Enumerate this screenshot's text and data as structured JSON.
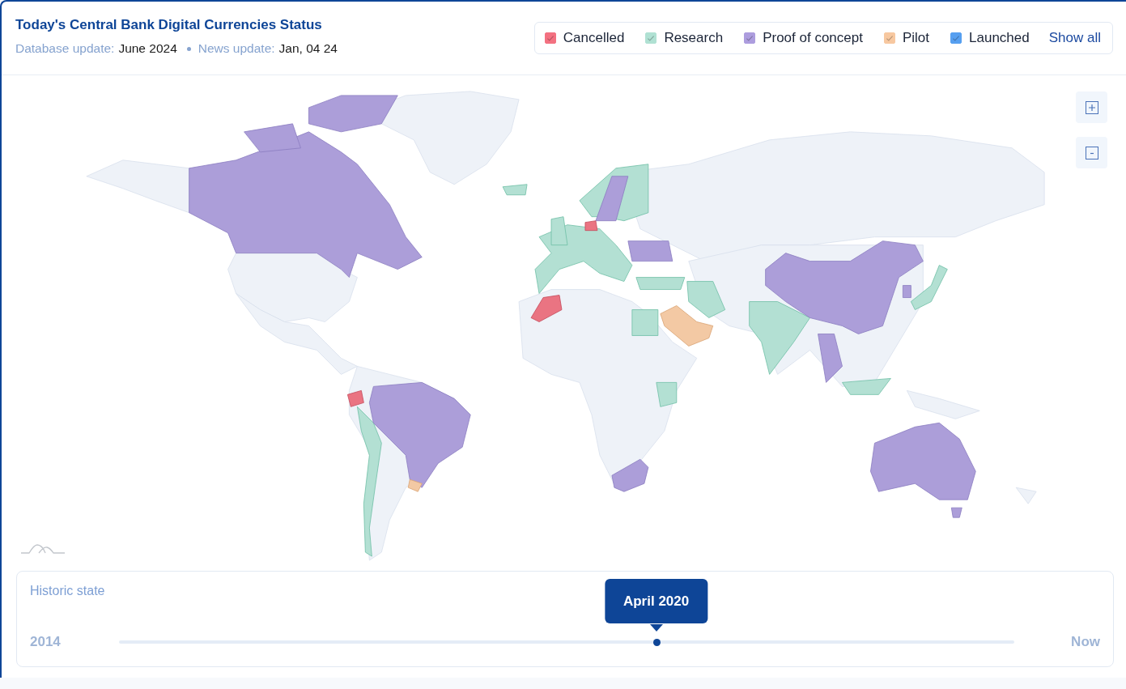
{
  "header": {
    "title": "Today's Central Bank Digital Currencies Status",
    "database_label": "Database update:",
    "database_value": "June 2024",
    "news_label": "News update:",
    "news_value": "Jan, 04 24"
  },
  "legend": {
    "items": [
      {
        "label": "Cancelled",
        "color": "#ea7482",
        "checked": true
      },
      {
        "label": "Research",
        "color": "#b3e0d3",
        "checked": true
      },
      {
        "label": "Proof of concept",
        "color": "#ac9ed9",
        "checked": true
      },
      {
        "label": "Pilot",
        "color": "#f3c9a4",
        "checked": true
      },
      {
        "label": "Launched",
        "color": "#5c9ee8",
        "checked": true
      }
    ],
    "show_all": "Show all"
  },
  "timeline": {
    "title": "Historic state",
    "start": "2014",
    "end": "Now",
    "tooltip": "April 2020",
    "level": 0.6
  }
}
